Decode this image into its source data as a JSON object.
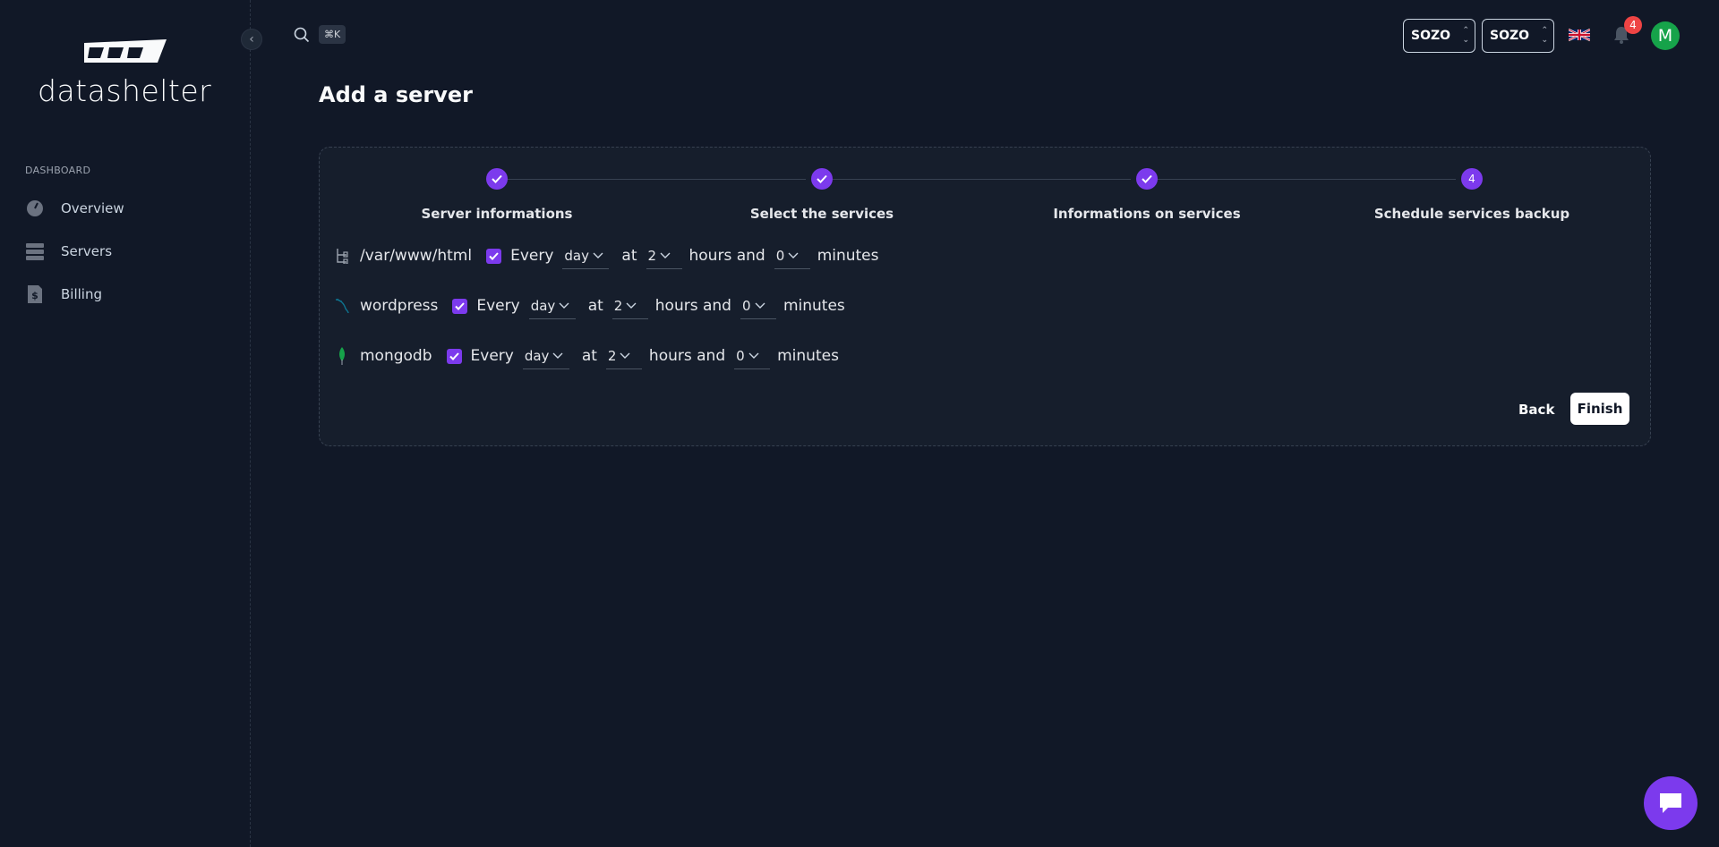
{
  "brand": {
    "name": "datashelter"
  },
  "sidebar": {
    "section": "DASHBOARD",
    "items": [
      {
        "label": "Overview",
        "icon": "gauge-icon"
      },
      {
        "label": "Servers",
        "icon": "servers-icon"
      },
      {
        "label": "Billing",
        "icon": "billing-icon"
      }
    ]
  },
  "topbar": {
    "search_shortcut": "⌘K",
    "org_select_1": "SOZO",
    "org_select_2": "SOZO",
    "notification_count": "4",
    "avatar_initial": "M"
  },
  "page": {
    "title": "Add a server"
  },
  "stepper": {
    "steps": [
      {
        "label": "Server informations",
        "state": "done"
      },
      {
        "label": "Select the services",
        "state": "done"
      },
      {
        "label": "Informations on services",
        "state": "done"
      },
      {
        "label": "Schedule services backup",
        "state": "active",
        "number": "4"
      }
    ]
  },
  "schedule": {
    "every_label": "Every",
    "at_label": "at",
    "hours_label": "hours and",
    "minutes_label": "minutes",
    "services": [
      {
        "name": "/var/www/html",
        "icon": "folder-tree-icon",
        "checked": true,
        "period": "day",
        "hour": "2",
        "minute": "0"
      },
      {
        "name": "wordpress",
        "icon": "mysql-dolphin-icon",
        "checked": true,
        "period": "day",
        "hour": "2",
        "minute": "0"
      },
      {
        "name": "mongodb",
        "icon": "mongodb-leaf-icon",
        "checked": true,
        "period": "day",
        "hour": "2",
        "minute": "0"
      }
    ]
  },
  "actions": {
    "back": "Back",
    "finish": "Finish"
  },
  "colors": {
    "accent": "#7c3aed",
    "background": "#111827",
    "badge": "#ef4444",
    "avatar": "#16a34a"
  }
}
